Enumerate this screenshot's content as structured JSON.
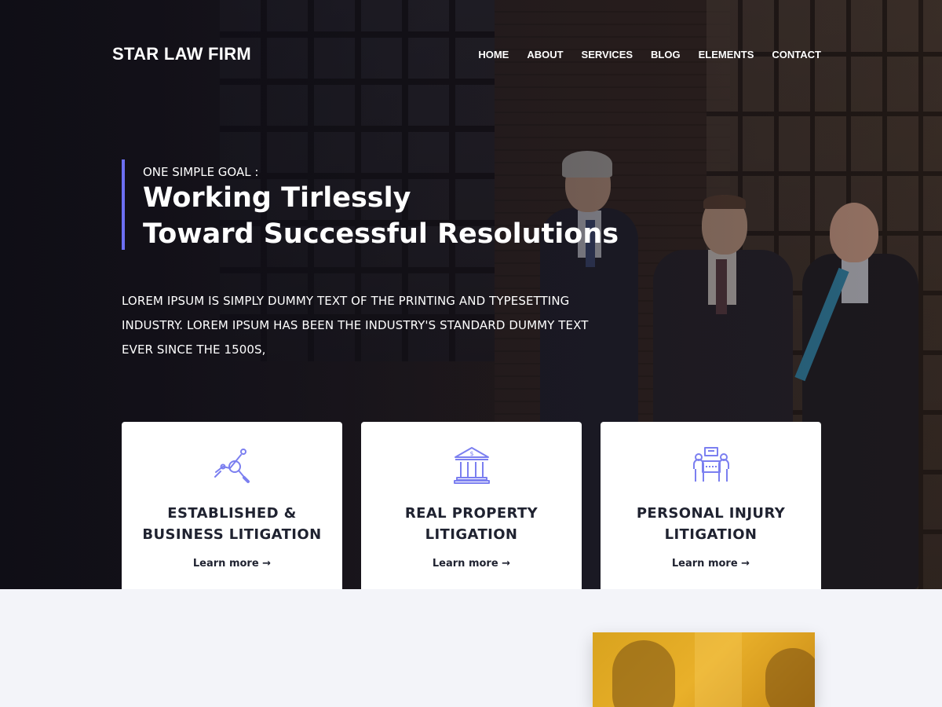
{
  "brand": {
    "name": "STAR LAW FIRM"
  },
  "nav": {
    "items": [
      {
        "label": "HOME"
      },
      {
        "label": "ABOUT"
      },
      {
        "label": "SERVICES"
      },
      {
        "label": "BLOG"
      },
      {
        "label": "ELEMENTS"
      },
      {
        "label": "CONTACT"
      }
    ]
  },
  "hero": {
    "eyebrow": "ONE SIMPLE GOAL :",
    "headline_line1": "Working Tirlessly",
    "headline_line2": "Toward Successful Resolutions",
    "description": "LOREM IPSUM IS SIMPLY DUMMY TEXT OF THE PRINTING AND TYPESETTING INDUSTRY. LOREM IPSUM HAS BEEN THE INDUSTRY'S STANDARD DUMMY TEXT EVER SINCE THE 1500S,"
  },
  "services": [
    {
      "icon": "business-analysis-icon",
      "title_line1": "ESTABLISHED &",
      "title_line2": "BUSINESS LITIGATION",
      "link": "Learn more →"
    },
    {
      "icon": "bank-building-icon",
      "title_line1": "REAL PROPERTY",
      "title_line2": "LITIGATION",
      "link": "Learn more →"
    },
    {
      "icon": "meeting-table-icon",
      "title_line1": "PERSONAL INJURY",
      "title_line2": "LITIGATION",
      "link": "Learn more →"
    }
  ],
  "colors": {
    "accent": "#6c6ff2",
    "icon": "#7b7ff0",
    "light_bg": "#f3f4f9",
    "photo_tint": "#e0a725"
  }
}
